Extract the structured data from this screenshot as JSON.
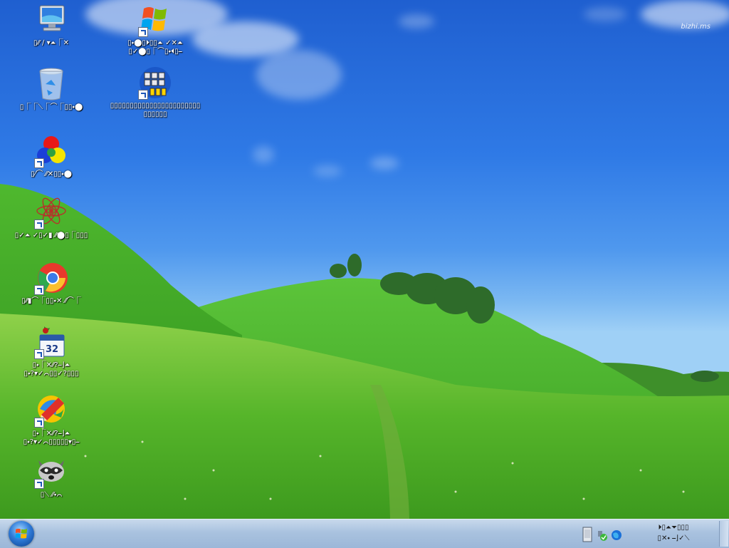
{
  "desktop": {
    "watermark": "bizhi.ms",
    "icons": [
      {
        "name": "computer",
        "label": "▯⁄⁄ ∕ ▾⏶⎾✕",
        "icon": "computer-icon"
      },
      {
        "name": "windows-shortcut",
        "label": "▯⬩⬤▯⏵▯▯⏶ ✓✕⏶\n▯✓⬤▯⎾⌒▯⬩⏴▯⎯",
        "icon": "windows-logo-icon"
      },
      {
        "name": "recycle-bin",
        "label": "▯⎾⎾⟍⎾⌒⎾▯▯⬩⬤",
        "icon": "recycle-bin-icon"
      },
      {
        "name": "app-grid-shortcut",
        "label": "▯▯▯▯▯▯▯▯▯▯▯▯▯▯▯▯▯▯▯▯▯▯▯▯▯▯▯▯▯",
        "icon": "grid-app-icon"
      },
      {
        "name": "color-balls-shortcut",
        "label": "▯⁄⌒ ⁄⁄✕▯▯⬩⬤",
        "icon": "color-balls-icon"
      },
      {
        "name": "atom-shortcut",
        "label": "▯✓⏶ ✓▯✓▮ ⁄⁄⬤▯⎾▯▯▯",
        "icon": "atom-flower-icon"
      },
      {
        "name": "chrome-shortcut",
        "label": "▯⁄⁄▮⌒⎾▯▯⬩✕ ⁄⁄⌒⎾",
        "icon": "chrome-icon"
      },
      {
        "name": "calendar-shortcut",
        "label": "▯⬩⎾✕⁄⁄?⎯⌋⏶\n▯⬩?▾✓⌒▯▯✓?▯▯▯",
        "icon": "calendar-32-icon"
      },
      {
        "name": "pencil-shortcut",
        "label": "▯⬩⎾✕⁄⁄?⎯⌋⏶\n▯⬩?▾✓⌒▯▯▯▯▯▾▯⎯",
        "icon": "pencil-app-icon"
      },
      {
        "name": "raccoon-shortcut",
        "label": "▯⟍ ⁄⁄⬩⌒",
        "icon": "raccoon-icon"
      }
    ]
  },
  "taskbar": {
    "start_icon": "windows-orb-icon",
    "tray_icons": [
      "device-icon",
      "network-icon",
      "globe-icon"
    ],
    "clock_line1": "⏵▯⏶⏷▯▯▯",
    "clock_line2": "▯✕⬩ ⎯⌋✓⟍"
  },
  "colors": {
    "sky_top": "#1f5fd0",
    "grass": "#3aa12a",
    "taskbar": "#a9c2df"
  }
}
